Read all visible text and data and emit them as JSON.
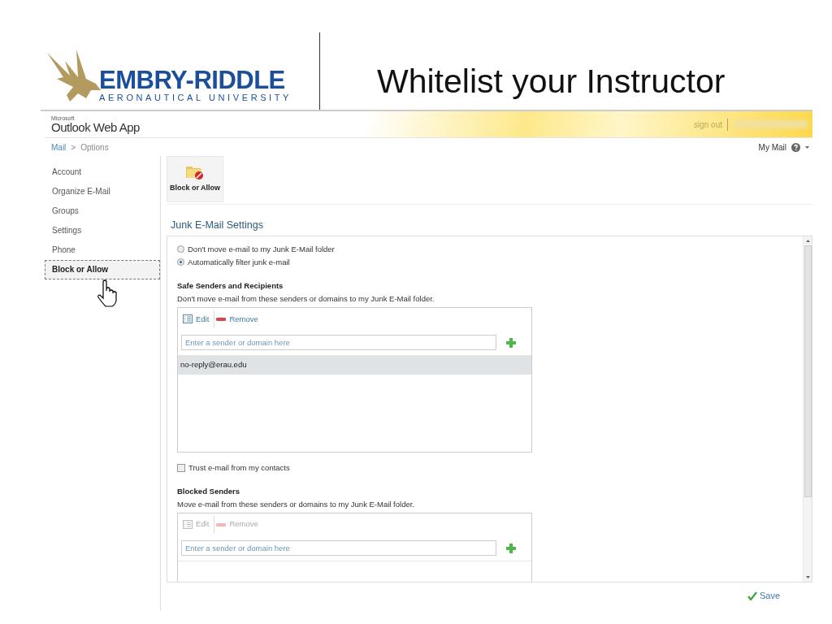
{
  "slide": {
    "logo": {
      "name": "EMBRY-RIDDLE",
      "subtitle": "AERONAUTICAL UNIVERSITY"
    },
    "title": "Whitelist your Instructor"
  },
  "app": {
    "brand_small": "Microsoft",
    "brand": "Outlook Web App",
    "sign_out": "sign out",
    "breadcrumb": [
      {
        "label": "Mail",
        "kind": "link"
      },
      {
        "label": ">",
        "kind": "separator"
      },
      {
        "label": "Options",
        "kind": "current"
      }
    ],
    "my_mail": "My Mail"
  },
  "sidebar": {
    "items": [
      {
        "label": "Account",
        "selected": false
      },
      {
        "label": "Organize E-Mail",
        "selected": false
      },
      {
        "label": "Groups",
        "selected": false
      },
      {
        "label": "Settings",
        "selected": false
      },
      {
        "label": "Phone",
        "selected": false
      },
      {
        "label": "Block or Allow",
        "selected": true
      }
    ]
  },
  "toolbar": {
    "items": [
      {
        "label": "Block or Allow",
        "selected": true
      }
    ]
  },
  "section": {
    "title": "Junk E-Mail Settings",
    "options": [
      {
        "label": "Don't move e-mail to my Junk E-Mail folder",
        "selected": false
      },
      {
        "label": "Automatically filter junk e-mail",
        "selected": true
      }
    ],
    "lists": [
      {
        "heading": "Safe Senders and Recipients",
        "description": "Don't move e-mail from these senders or domains to my Junk E-Mail folder.",
        "edit": "Edit",
        "remove": "Remove",
        "disabled": false,
        "placeholder": "Enter a sender or domain here",
        "entries": [
          {
            "text": "no-reply@erau.edu",
            "selected": true
          }
        ],
        "trust": {
          "label": "Trust e-mail from my contacts",
          "checked": false
        }
      },
      {
        "heading": "Blocked Senders",
        "description": "Move e-mail from these senders or domains to my Junk E-Mail folder.",
        "edit": "Edit",
        "remove": "Remove",
        "disabled": true,
        "placeholder": "Enter a sender or domain here"
      }
    ]
  },
  "save": "Save"
}
